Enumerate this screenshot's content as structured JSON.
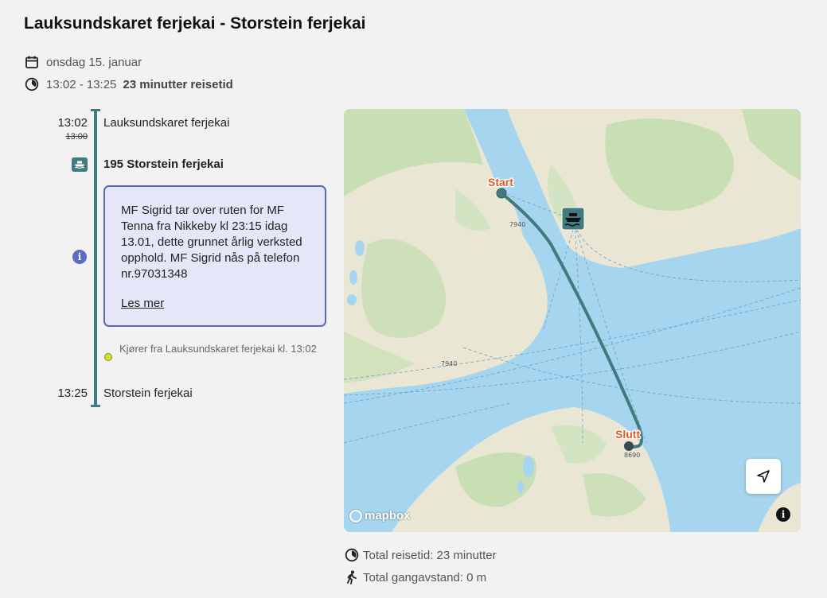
{
  "trip": {
    "title": "Lauksundskaret ferjekai - Storstein ferjekai",
    "date": "onsdag 15. januar",
    "time_range": "13:02 - 13:25",
    "duration": "23 minutter reisetid"
  },
  "timeline": {
    "start": {
      "time": "13:02",
      "planned_time": "13:00",
      "stop": "Lauksundskaret ferjekai"
    },
    "line": {
      "icon": "ferry-icon",
      "name": "195 Storstein ferjekai"
    },
    "notice": {
      "icon": "info-icon",
      "text": "MF Sigrid tar over ruten for MF Tenna fra Nikkeby kl 23:15 idag 13.01, dette grunnet årlig verksted opphold. MF Sigrid nås på telefon nr.97031348",
      "link": "Les mer"
    },
    "departure_note": "Kjører fra Lauksundskaret ferjekai kl. 13:02",
    "end": {
      "time": "13:25",
      "stop": "Storstein ferjekai"
    }
  },
  "map": {
    "start_label": "Start",
    "end_label": "Slutt",
    "road_label_1": "7940",
    "road_label_2": "7940",
    "road_label_3": "8690",
    "logo": "mapbox",
    "locate_icon": "navigation-arrow-icon",
    "attribution_icon": "info-icon",
    "colors": {
      "water": "#a6d6ef",
      "land": "#eae6d4",
      "forest": "#c7dfb3",
      "route": "#437a7f",
      "marker_label": "#e35a1e"
    }
  },
  "summary": {
    "total_time": "Total reisetid: 23 minutter",
    "walk_distance": "Total gangavstand: 0 m"
  }
}
